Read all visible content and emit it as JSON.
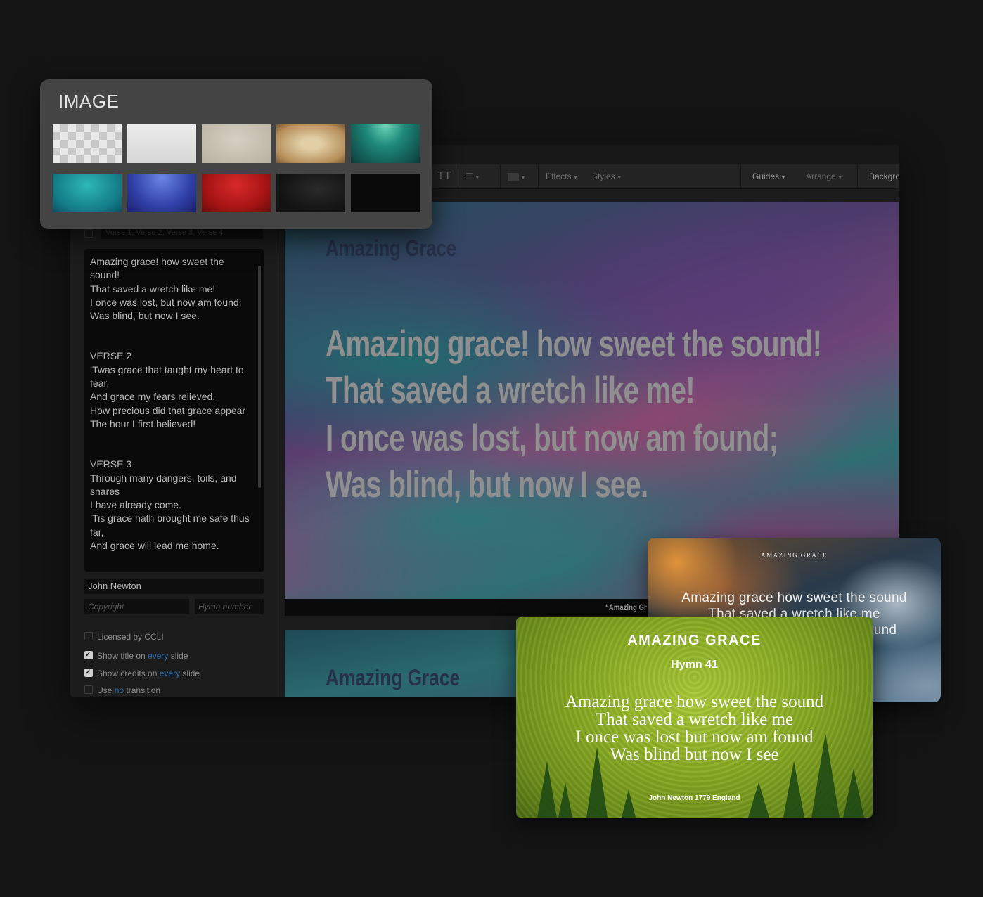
{
  "toolbar": {
    "text_case": "TT",
    "effects": "Effects",
    "styles": "Styles",
    "guides": "Guides",
    "arrange": "Arrange",
    "background": "Backgro"
  },
  "sidebar": {
    "order_placeholder": "Verse 1, Verse 2, Verse 3, Verse 4,",
    "lyrics": [
      "Amazing grace! how sweet the sound!\nThat saved a wretch like me!\nI once was lost, but now am found;\nWas blind, but now I see.",
      "VERSE 2\n’Twas grace that taught my heart to fear,\nAnd grace my fears relieved.\nHow precious did that grace appear\nThe hour I first believed!",
      "VERSE 3\nThrough many dangers, toils, and snares\nI have already come.\n’Tis grace hath brought me safe thus far,\nAnd grace will lead me home."
    ],
    "author": "John Newton",
    "copyright_placeholder": "Copyright",
    "hymn_placeholder": "Hymn number",
    "options": {
      "licensed": {
        "label": "Licensed by CCLI",
        "checked": false
      },
      "show_title": {
        "pre": "Show title on",
        "link": "every",
        "post": "slide",
        "checked": true
      },
      "show_credits": {
        "pre": "Show credits on",
        "link": "every",
        "post": "slide",
        "checked": true
      },
      "transition": {
        "pre": "Use",
        "link": "no",
        "post": "transition",
        "checked": false
      }
    }
  },
  "slide": {
    "title": "Amazing Grace",
    "lines": [
      "Amazing grace! how sweet the sound!",
      "That saved a wretch like me!",
      "I once was lost, but now am found;",
      "Was blind, but now I see."
    ],
    "footer": "“Amazing Gr"
  },
  "second_slide": {
    "title": "Amazing Grace"
  },
  "image_picker": {
    "title": "IMAGE",
    "swatches": [
      "transparent",
      "white",
      "linen",
      "parchment",
      "teal-glow",
      "aqua",
      "blue",
      "red",
      "dark-texture",
      "black"
    ]
  },
  "card_sky": {
    "title": "AMAZING GRACE",
    "lines": "Amazing grace how sweet the sound\nThat saved a wretch like me\nI once was lost but now am found"
  },
  "card_green": {
    "title": "AMAZING GRACE",
    "subtitle": "Hymn 41",
    "lines": "Amazing grace how sweet the sound\nThat saved a wretch like me\nI once was lost but now am found\nWas blind but now I see",
    "credit": "John Newton 1779 England"
  }
}
